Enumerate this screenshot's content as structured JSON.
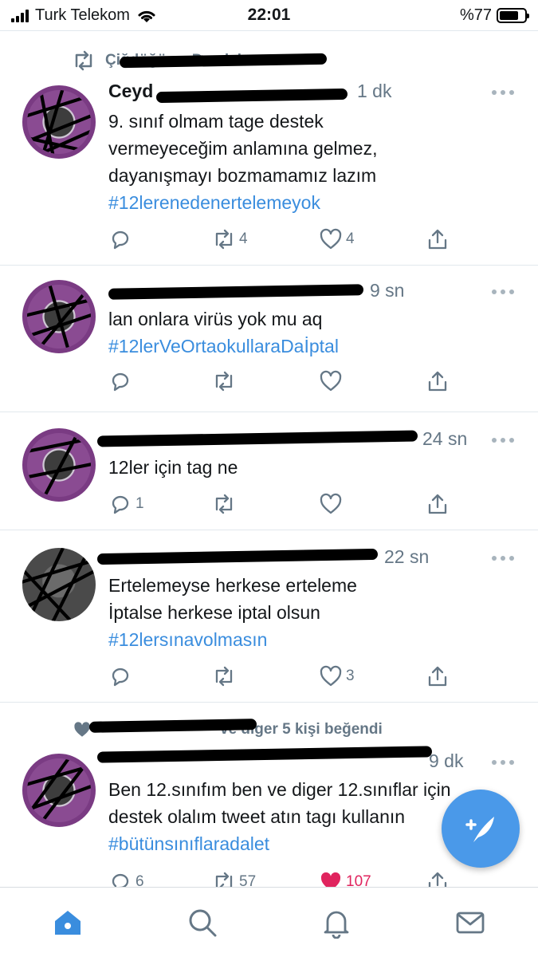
{
  "status_bar": {
    "carrier": "Turk Telekom",
    "time": "22:01",
    "battery": "%77",
    "battery_level": 0.77
  },
  "feed": {
    "tweets": [
      {
        "social_context": "Çiğdöğü ve Damlalı",
        "name": "Ceyd",
        "time": "1 dk",
        "lines": [
          "9. sınıf olmam tage destek",
          "vermeyeceğim anlamına gelmez,",
          "dayanışmayı bozmamamız lazım"
        ],
        "hashtag": "#12lerenedenertelemeyok",
        "replies": "",
        "retweets": "4",
        "likes": "4"
      },
      {
        "time": "9 sn",
        "lines": [
          "lan onlara virüs yok mu aq"
        ],
        "hashtag": "#12lerVeOrtaokullaraDaİptal",
        "replies": "",
        "retweets": "",
        "likes": ""
      },
      {
        "time": "24 sn",
        "lines": [
          "12ler için tag ne"
        ],
        "hashtag": "",
        "replies": "1",
        "retweets": "",
        "likes": ""
      },
      {
        "time": "22 sn",
        "lines": [
          "Ertelemeyse herkese erteleme",
          "İptalse herkese iptal olsun"
        ],
        "hashtag": "#12lersınavolmasın",
        "replies": "",
        "retweets": "",
        "likes": "3"
      },
      {
        "social_context": "ve diger 5 kişi beğendi",
        "time": "9 dk",
        "lines": [
          "Ben 12.sınıfım ben ve diger 12.sınıflar için",
          "destek olalım tweet atın tagı kullanın"
        ],
        "hashtag": "#bütünsınıflaradalet",
        "replies": "6",
        "retweets": "57",
        "likes": "107"
      }
    ]
  },
  "colors": {
    "accent": "#3a8dde",
    "liked": "#e0245e",
    "secondary_text": "#657786"
  },
  "icons": {
    "reply": "reply-icon",
    "retweet": "retweet-icon",
    "like": "heart-icon",
    "share": "share-icon",
    "compose": "compose-tweet-icon",
    "tabs": [
      "home-icon",
      "search-icon",
      "notifications-icon",
      "messages-icon"
    ]
  }
}
